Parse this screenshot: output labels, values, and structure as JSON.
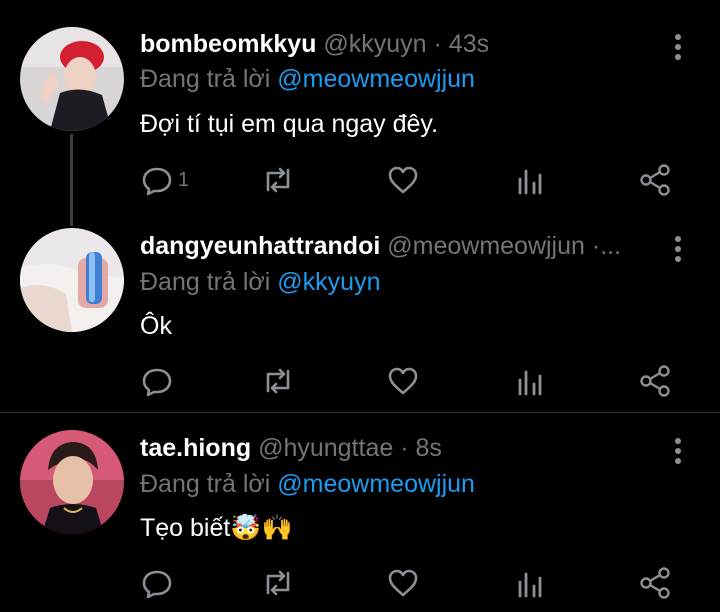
{
  "tweets": [
    {
      "name": "bombeomkkyu",
      "meta": "@kkyuyn · 43s",
      "reply_prefix": "Đang trả lời ",
      "reply_to": "@meowmeowjjun",
      "text": "Đợi tí tụi em qua ngay đêy.",
      "reply_count": "1"
    },
    {
      "name": "dangyeunhattrandoi",
      "meta": "@meowmeowjjun ·...",
      "reply_prefix": "Đang trả lời ",
      "reply_to": "@kkyuyn",
      "text": "Ôk",
      "reply_count": ""
    },
    {
      "name": "tae.hiong",
      "meta": "@hyungttae · 8s",
      "reply_prefix": "Đang trả lời ",
      "reply_to": "@meowmeowjjun",
      "text": "Tẹo biết🤯🙌",
      "reply_count": ""
    }
  ],
  "colors": {
    "background": "#000000",
    "mention": "#1d9bf0",
    "muted": "#71767b",
    "divider": "#2f3336"
  },
  "icons": [
    "reply-icon",
    "retweet-icon",
    "like-icon",
    "analytics-icon",
    "share-icon",
    "more-icon"
  ]
}
